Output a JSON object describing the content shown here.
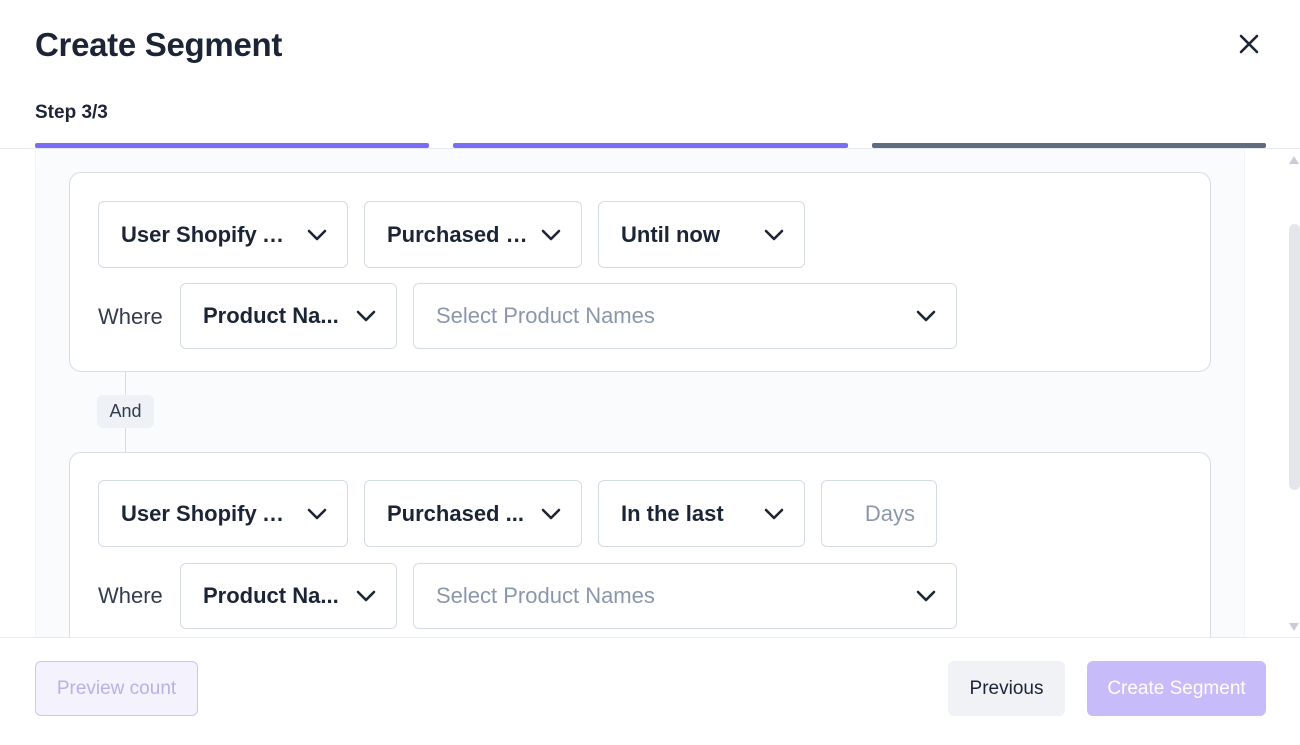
{
  "colors": {
    "progress_done": "#7b6cf6",
    "progress_current": "#5f6b7f",
    "accent_light": "#c7bbfa"
  },
  "header": {
    "title": "Create Segment",
    "step": "Step 3/3",
    "close_icon": "close-icon"
  },
  "rules": [
    {
      "event_dropdown": "User Shopify Ac...",
      "action_dropdown": "Purchased a...",
      "time_dropdown": "Until now",
      "where_label": "Where",
      "property_dropdown": "Product Na...",
      "value_placeholder": "Select Product Names"
    },
    {
      "event_dropdown": "User Shopify Ac...",
      "action_dropdown": "Purchased ...",
      "time_dropdown": "In the last",
      "days_placeholder": "Days",
      "where_label": "Where",
      "property_dropdown": "Product Na...",
      "value_placeholder": "Select Product Names"
    }
  ],
  "connector": {
    "label": "And"
  },
  "footer": {
    "preview_label": "Preview count",
    "previous_label": "Previous",
    "create_label": "Create Segment"
  }
}
